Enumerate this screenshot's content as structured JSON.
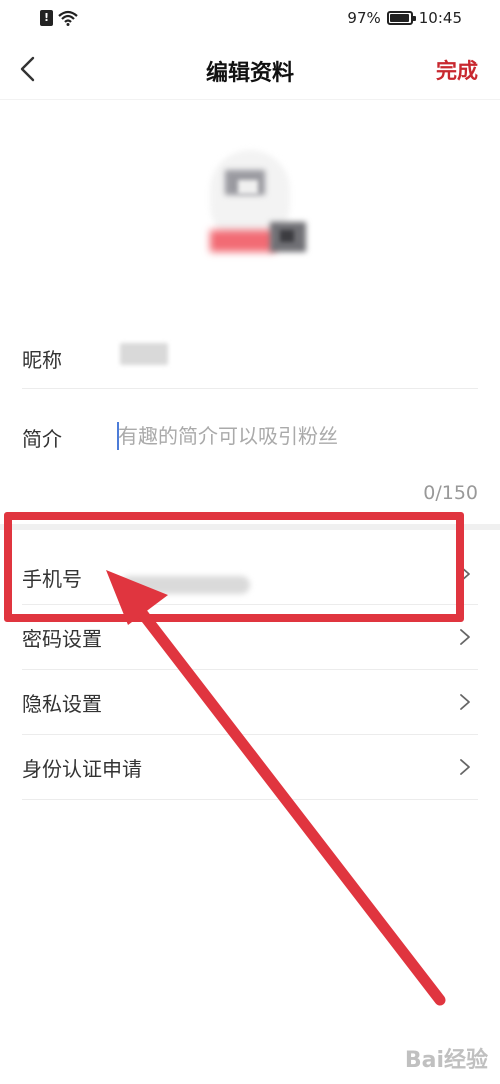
{
  "status_bar": {
    "battery": "97%",
    "time": "10:45"
  },
  "nav": {
    "title": "编辑资料",
    "done_label": "完成"
  },
  "form": {
    "nickname_label": "昵称",
    "bio_label": "简介",
    "bio_placeholder": "有趣的简介可以吸引粉丝",
    "bio_counter": "0/150",
    "phone_label": "手机号",
    "menu": [
      {
        "label": "密码设置"
      },
      {
        "label": "隐私设置"
      },
      {
        "label": "身份认证申请"
      }
    ]
  },
  "colors": {
    "accent": "#c8282f",
    "annotation": "#e0353f"
  },
  "watermark": "Bai经验"
}
